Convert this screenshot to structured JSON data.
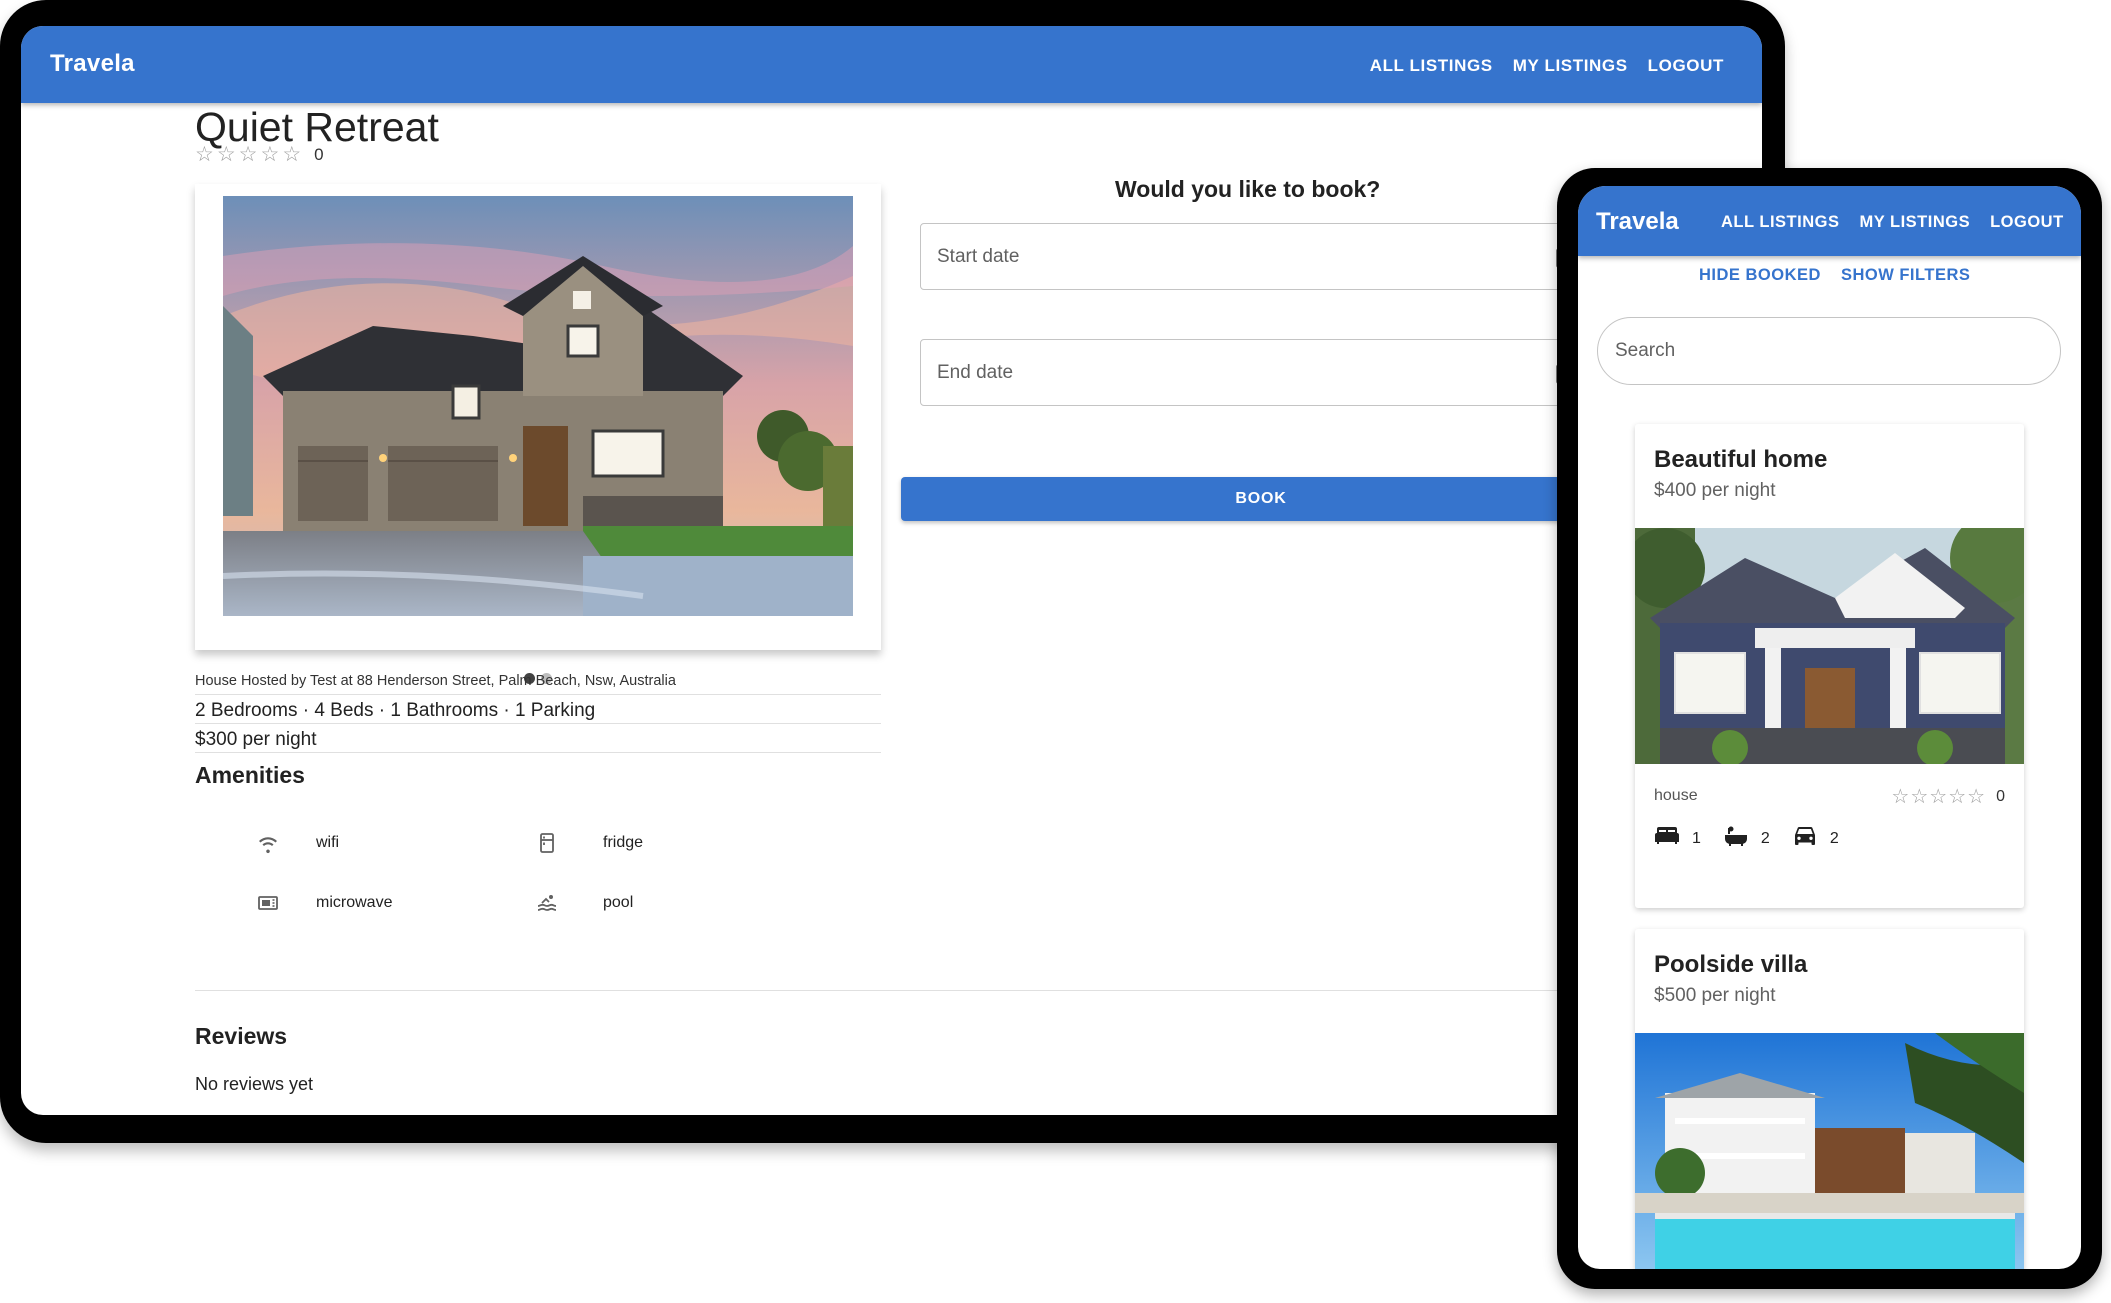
{
  "desktop": {
    "app_bar": {
      "brand": "Travela",
      "nav": [
        "ALL LISTINGS",
        "MY LISTINGS",
        "LOGOUT"
      ]
    },
    "listing": {
      "title": "Quiet Retreat",
      "rating": {
        "stars": 0,
        "max": 5,
        "count": "0"
      },
      "carousel": {
        "slides": 2,
        "active": 1
      },
      "hosted": "House Hosted by Test at 88 Henderson Street, Palm Beach, Nsw, Australia",
      "facts": "2 Bedrooms · 4 Beds · 1 Bathrooms · 1 Parking",
      "price": "$300 per night",
      "amenities_title": "Amenities",
      "amenities": [
        {
          "label": "wifi",
          "icon": "wifi-icon"
        },
        {
          "label": "fridge",
          "icon": "fridge-icon"
        },
        {
          "label": "microwave",
          "icon": "microwave-icon"
        },
        {
          "label": "pool",
          "icon": "pool-icon"
        }
      ],
      "reviews_title": "Reviews",
      "reviews_empty": "No reviews yet"
    },
    "booking": {
      "question": "Would you like to book?",
      "start_placeholder": "Start date",
      "end_placeholder": "End date",
      "book_label": "BOOK"
    }
  },
  "mobile": {
    "app_bar": {
      "brand": "Travela",
      "nav": [
        "ALL LISTINGS",
        "MY LISTINGS",
        "LOGOUT"
      ]
    },
    "toggles": [
      "HIDE BOOKED",
      "SHOW FILTERS"
    ],
    "search_placeholder": "Search",
    "listings": [
      {
        "title": "Beautiful home",
        "price": "$400 per night",
        "type": "house",
        "rating": {
          "stars": 0,
          "max": 5,
          "count": "0"
        },
        "features": [
          {
            "icon": "bed-icon",
            "value": "1"
          },
          {
            "icon": "bathtub-icon",
            "value": "2"
          },
          {
            "icon": "car-icon",
            "value": "2"
          }
        ]
      },
      {
        "title": "Poolside villa",
        "price": "$500 per night"
      }
    ]
  },
  "colors": {
    "primary": "#3674cd",
    "device": "#000000",
    "text": "#212121",
    "muted": "#616161"
  }
}
